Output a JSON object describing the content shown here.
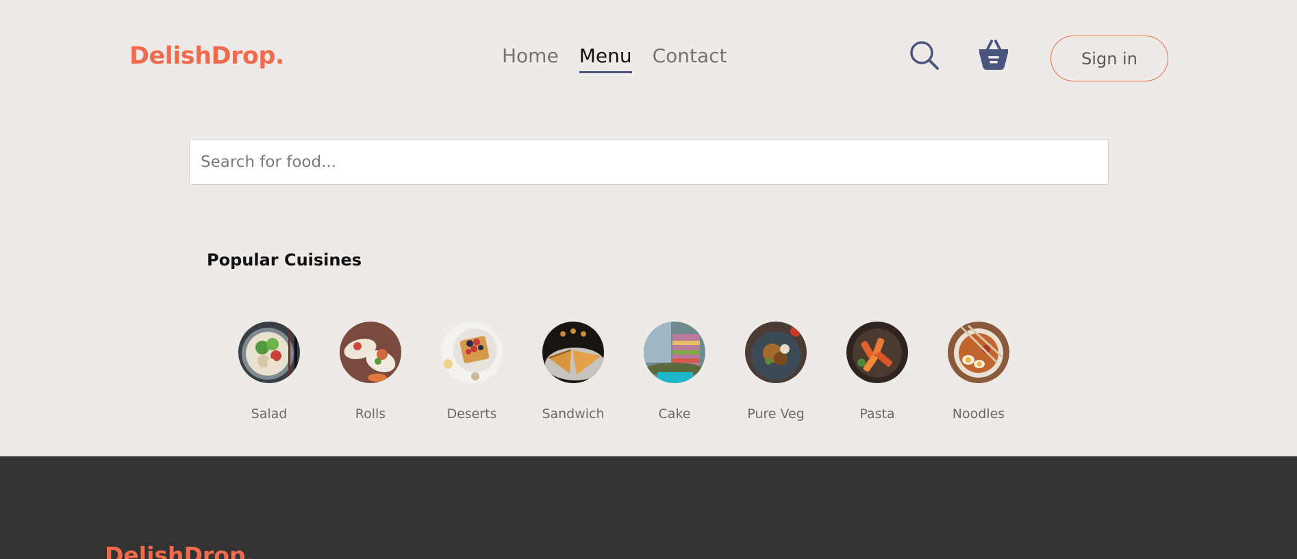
{
  "brand": {
    "logo": "DelishDrop.",
    "accent_color": "#f06a4d",
    "nav_underline_color": "#49557e"
  },
  "nav": {
    "items": [
      {
        "label": "Home",
        "active": false
      },
      {
        "label": "Menu",
        "active": true
      },
      {
        "label": "Contact",
        "active": false
      }
    ],
    "search_icon": "search-icon",
    "cart_icon": "basket-icon",
    "signin_label": "Sign in"
  },
  "search": {
    "placeholder": "Search for food...",
    "value": ""
  },
  "section": {
    "title": "Popular Cuisines"
  },
  "cuisines": [
    {
      "label": "Salad",
      "image": "salad-bowl"
    },
    {
      "label": "Rolls",
      "image": "wraps"
    },
    {
      "label": "Deserts",
      "image": "waffle-berries"
    },
    {
      "label": "Sandwich",
      "image": "toasted-sandwich"
    },
    {
      "label": "Cake",
      "image": "layer-cake"
    },
    {
      "label": "Pure Veg",
      "image": "veg-plate"
    },
    {
      "label": "Pasta",
      "image": "penne-pasta"
    },
    {
      "label": "Noodles",
      "image": "ramen-bowl"
    }
  ],
  "footer": {
    "logo": "DelishDrop."
  }
}
